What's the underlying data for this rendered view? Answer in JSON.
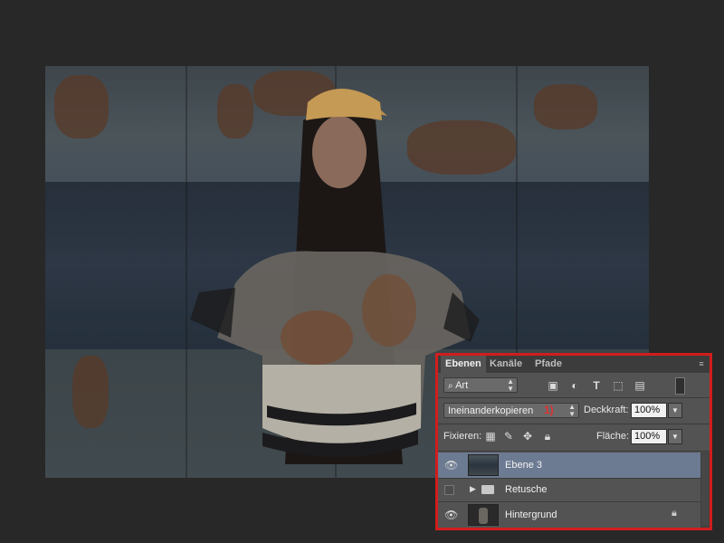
{
  "panel": {
    "tabs": [
      {
        "label": "Ebenen"
      },
      {
        "label": "Kanäle"
      },
      {
        "label": "Pfade"
      }
    ],
    "filter_select": "Art",
    "blend_mode": "Ineinanderkopieren",
    "annotation_marker": "1)",
    "opacity_label": "Deckkraft:",
    "opacity_value": "100%",
    "lock_label": "Fixieren:",
    "fill_label": "Fläche:",
    "fill_value": "100%",
    "layers": [
      {
        "name": "Ebene 3",
        "visible": true,
        "selected": true
      },
      {
        "name": "Retusche",
        "visible": false,
        "selected": false,
        "type": "group"
      },
      {
        "name": "Hintergrund",
        "visible": true,
        "selected": false,
        "locked": true
      }
    ]
  },
  "colors": {
    "highlight_border": "#d21d1d",
    "selected_layer": "#6c7a92",
    "panel_bg": "#535353",
    "app_bg": "#282828"
  }
}
